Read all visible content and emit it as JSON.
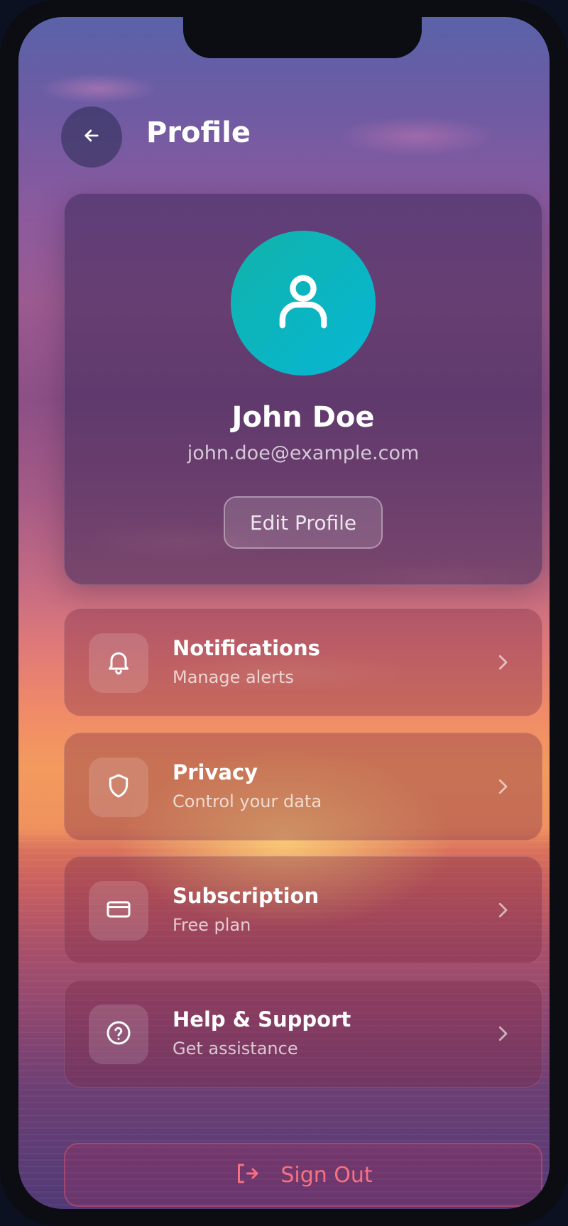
{
  "header": {
    "title": "Profile",
    "back_icon": "arrow-left-icon"
  },
  "profile": {
    "name": "John Doe",
    "email": "john.doe@example.com",
    "edit_label": "Edit Profile",
    "avatar_icon": "user-icon",
    "avatar_color": "#06b6d4"
  },
  "menu": {
    "items": [
      {
        "title": "Notifications",
        "subtitle": "Manage alerts",
        "icon": "bell-icon"
      },
      {
        "title": "Privacy",
        "subtitle": "Control your data",
        "icon": "shield-icon"
      },
      {
        "title": "Subscription",
        "subtitle": "Free plan",
        "icon": "credit-card-icon"
      },
      {
        "title": "Help & Support",
        "subtitle": "Get assistance",
        "icon": "help-circle-icon"
      }
    ]
  },
  "sign_out": {
    "label": "Sign Out",
    "icon": "log-out-icon",
    "color": "#f87181"
  }
}
